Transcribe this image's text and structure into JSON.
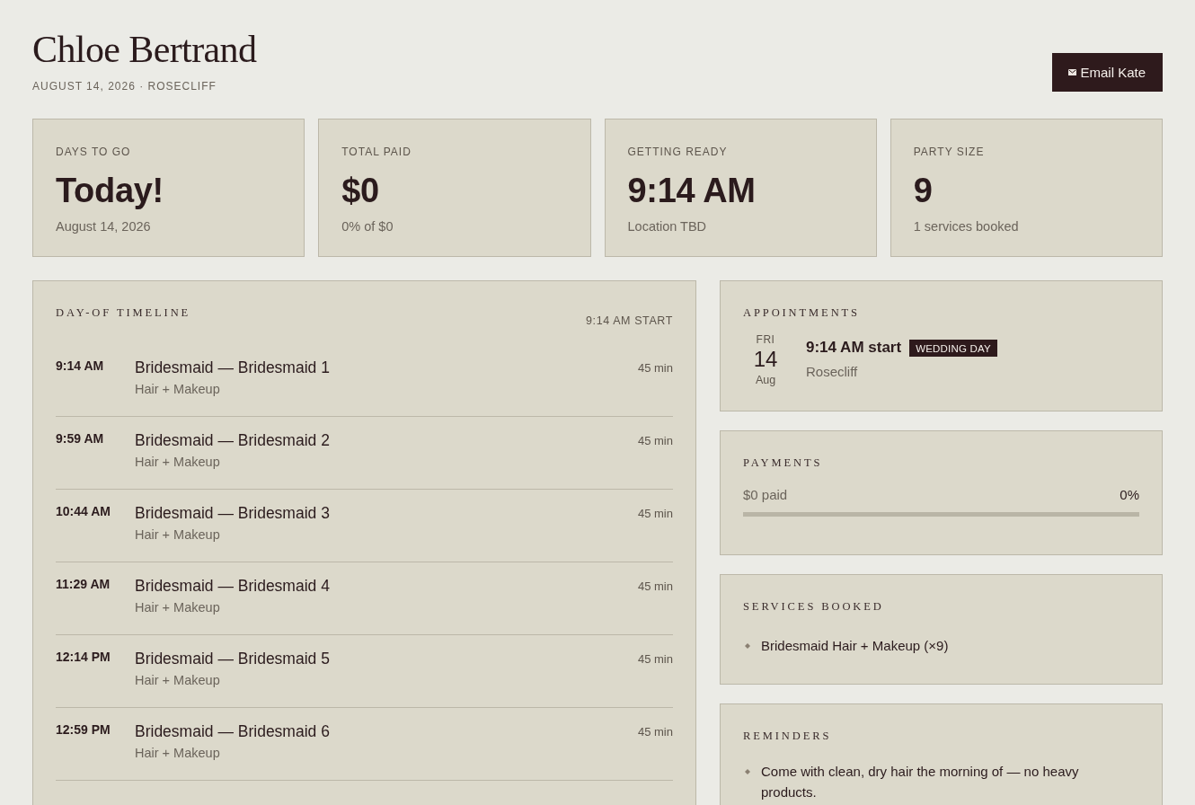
{
  "header": {
    "title": "Chloe Bertrand",
    "subtitle": "AUGUST 14, 2026 · ROSECLIFF",
    "button": "Email Kate"
  },
  "stats": [
    {
      "label": "DAYS TO GO",
      "value": "Today!",
      "note": "August 14, 2026"
    },
    {
      "label": "TOTAL PAID",
      "value": "$0",
      "note": "0% of $0"
    },
    {
      "label": "GETTING READY",
      "value": "9:14 AM",
      "note": "Location TBD"
    },
    {
      "label": "PARTY SIZE",
      "value": "9",
      "note": "1 services booked"
    }
  ],
  "timeline": {
    "title": "DAY-OF TIMELINE",
    "start": "9:14 AM START",
    "rows": [
      {
        "time": "9:14 AM",
        "title": "Bridesmaid — Bridesmaid 1",
        "service": "Hair + Makeup",
        "duration": "45 min"
      },
      {
        "time": "9:59 AM",
        "title": "Bridesmaid — Bridesmaid 2",
        "service": "Hair + Makeup",
        "duration": "45 min"
      },
      {
        "time": "10:44 AM",
        "title": "Bridesmaid — Bridesmaid 3",
        "service": "Hair + Makeup",
        "duration": "45 min"
      },
      {
        "time": "11:29 AM",
        "title": "Bridesmaid — Bridesmaid 4",
        "service": "Hair + Makeup",
        "duration": "45 min"
      },
      {
        "time": "12:14 PM",
        "title": "Bridesmaid — Bridesmaid 5",
        "service": "Hair + Makeup",
        "duration": "45 min"
      },
      {
        "time": "12:59 PM",
        "title": "Bridesmaid — Bridesmaid 6",
        "service": "Hair + Makeup",
        "duration": "45 min"
      }
    ]
  },
  "appointments": {
    "title": "APPOINTMENTS",
    "items": [
      {
        "weekday": "FRI",
        "day": "14",
        "month": "Aug",
        "title": "9:14 AM start",
        "tag": "WEDDING DAY",
        "location": "Rosecliff"
      }
    ]
  },
  "payments": {
    "title": "PAYMENTS",
    "paid": "$0 paid",
    "percent": "0%",
    "level": 0
  },
  "services": {
    "title": "SERVICES BOOKED",
    "items": [
      "Bridesmaid Hair + Makeup (×9)"
    ]
  },
  "reminders": {
    "title": "REMINDERS",
    "items": [
      "Come with clean, dry hair the morning of — no heavy products."
    ]
  }
}
